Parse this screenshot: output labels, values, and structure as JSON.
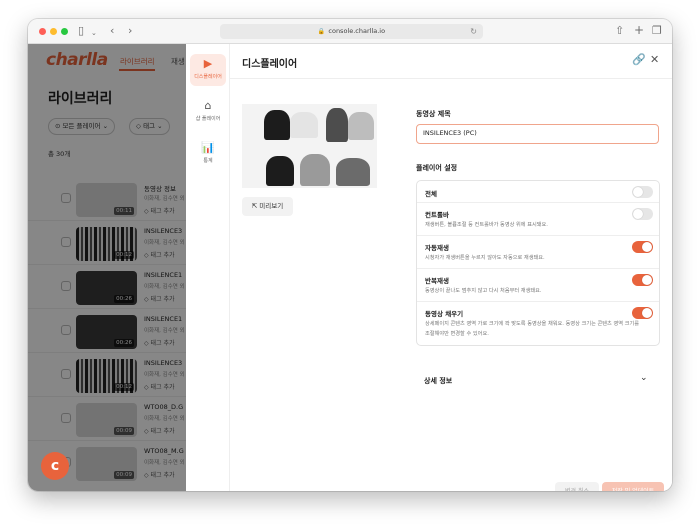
{
  "browser": {
    "url": "console.charlla.io"
  },
  "left": {
    "logo": "charlla",
    "nav": [
      "라이브러리",
      "재생"
    ],
    "page_title": "라이브러리",
    "chips": [
      "모든 플레이어",
      "태그"
    ],
    "count": "총 30개",
    "rows": [
      {
        "title": "동영상 정보",
        "sub": "이화재, 김수연 외",
        "tag": "태그 추가",
        "duration": "00:11"
      },
      {
        "title": "INSILENCE3",
        "sub": "이화재, 김수연 외",
        "tag": "태그 추가",
        "duration": "00:12"
      },
      {
        "title": "INSILENCE1",
        "sub": "이화재, 김수연 외",
        "tag": "태그 추가",
        "duration": "00:26"
      },
      {
        "title": "INSILENCE1",
        "sub": "이화재, 김수연 외",
        "tag": "태그 추가",
        "duration": "00:26"
      },
      {
        "title": "INSILENCE3",
        "sub": "이화재, 김수연 외",
        "tag": "태그 추가",
        "duration": "00:12"
      },
      {
        "title": "WTO08_D.G",
        "sub": "이화재, 김수연 외",
        "tag": "태그 추가",
        "duration": "00:09"
      },
      {
        "title": "WTO08_M.G",
        "sub": "이화재, 김수연 외",
        "tag": "태그 추가",
        "duration": "00:09"
      }
    ]
  },
  "rail": {
    "items": [
      {
        "label": "디스플레이어",
        "icon": "display-icon",
        "glyph": "▶"
      },
      {
        "label": "샵 플레이어",
        "icon": "shop-icon",
        "glyph": "⌂"
      },
      {
        "label": "통계",
        "icon": "stats-icon",
        "glyph": "📊"
      }
    ]
  },
  "panel": {
    "title": "디스플레이어",
    "preview_label": "미리보기",
    "video_title_label": "동영상 제목",
    "video_title_value": "INSILENCE3 (PC)",
    "player_settings_label": "플레이어 설정",
    "settings": [
      {
        "title": "전체",
        "desc": "",
        "on": false
      },
      {
        "title": "컨트롤바",
        "desc": "재생버튼, 볼륨조절 등 컨트롤바가 동영상 위에 표시돼요.",
        "on": false
      },
      {
        "title": "자동재생",
        "desc": "시청자가 재생버튼을 누르지 않아도 자동으로 재생돼요.",
        "on": true
      },
      {
        "title": "반복재생",
        "desc": "동영상이 끝나도 멈추지 않고 다시 처음부터 재생돼요.",
        "on": true
      },
      {
        "title": "동영상 채우기",
        "desc": "상세페이지 콘텐츠 영역 가로 크기에 꽉 맞도록 동영상을 채워요. 동영상 크기는 콘텐츠 영역 크기를 조절해야만 변경할 수 있어요.",
        "on": true
      }
    ],
    "detail_label": "상세 정보",
    "cancel_label": "변경 취소",
    "save_label": "저장 및 업데이트"
  },
  "colors": {
    "accent": "#e8633c",
    "accent_light": "#fde9e3"
  }
}
